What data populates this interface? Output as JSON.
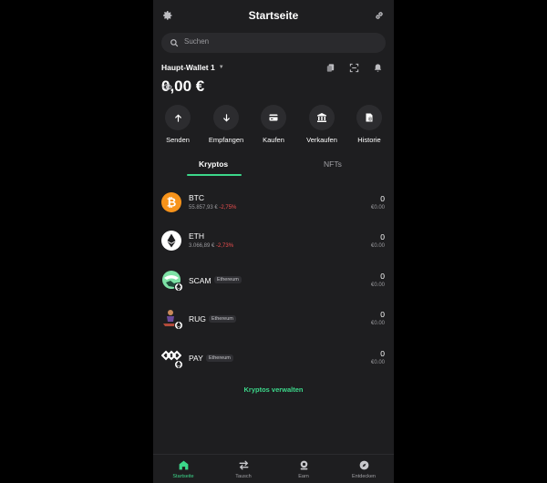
{
  "header": {
    "title": "Startseite",
    "settings_icon": "gear-icon",
    "connect_icon": "link-icon"
  },
  "search": {
    "placeholder": "Suchen"
  },
  "wallet": {
    "name": "Haupt-Wallet 1",
    "balance": "0,00 €",
    "icons": [
      "copy-icon",
      "scan-icon",
      "bell-icon"
    ]
  },
  "actions": [
    {
      "label": "Senden",
      "icon": "arrow-up-icon"
    },
    {
      "label": "Empfangen",
      "icon": "arrow-down-icon"
    },
    {
      "label": "Kaufen",
      "icon": "card-icon"
    },
    {
      "label": "Verkaufen",
      "icon": "bank-icon"
    },
    {
      "label": "Historie",
      "icon": "history-icon"
    }
  ],
  "tabs": {
    "kryptos": "Kryptos",
    "nfts": "NFTs",
    "active": "Kryptos"
  },
  "assets": [
    {
      "symbol": "BTC",
      "price": "55.857,93 €",
      "change": "-2,75%",
      "amount": "0",
      "fiat": "€0.00",
      "color": "#f7931a"
    },
    {
      "symbol": "ETH",
      "price": "3.066,89 €",
      "change": "-2,73%",
      "amount": "0",
      "fiat": "€0.00",
      "color": "#ffffff"
    },
    {
      "symbol": "SCAM",
      "chain": "Ethereum",
      "amount": "0",
      "fiat": "€0.00"
    },
    {
      "symbol": "RUG",
      "chain": "Ethereum",
      "amount": "0",
      "fiat": "€0.00"
    },
    {
      "symbol": "PAY",
      "chain": "Ethereum",
      "amount": "0",
      "fiat": "€0.00"
    }
  ],
  "manage_label": "Kryptos verwalten",
  "nav": [
    {
      "label": "Startseite",
      "icon": "home-icon",
      "active": true
    },
    {
      "label": "Tausch",
      "icon": "swap-icon"
    },
    {
      "label": "Earn",
      "icon": "earn-icon"
    },
    {
      "label": "Entdecken",
      "icon": "compass-icon"
    }
  ],
  "colors": {
    "accent": "#3cd78a",
    "negative": "#ef4f4f",
    "background": "#1e1e20"
  }
}
